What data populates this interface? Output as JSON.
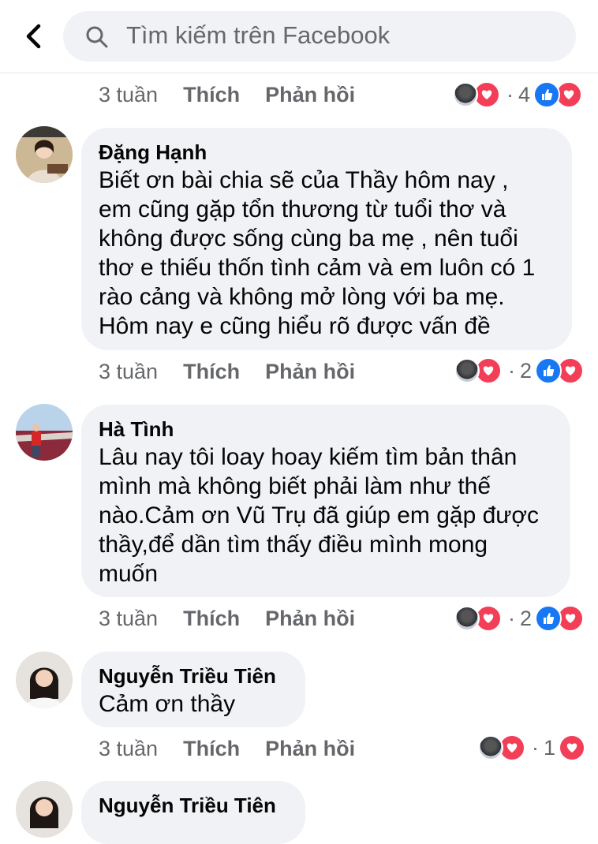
{
  "search": {
    "placeholder": "Tìm kiếm trên Facebook"
  },
  "labels": {
    "like": "Thích",
    "reply": "Phản hồi"
  },
  "colors": {
    "like_blue": "#1877f2",
    "love_red": "#f33e58",
    "bubble_bg": "#f0f2f5",
    "meta_gray": "#65676b"
  },
  "top_meta": {
    "time": "3 tuần",
    "reaction_count": "4"
  },
  "comments": [
    {
      "author": "Đặng Hạnh",
      "text": "Biết ơn bài chia sẽ của Thầy hôm nay ,\nem  cũng gặp tổn thương từ tuổi thơ và\nkhông được sống cùng ba mẹ , nên tuổi\nthơ e thiếu thốn tình cảm và em luôn có 1\nrào cảng và không mở lòng với ba mẹ.\nHôm nay e cũng hiểu rõ được vấn đề",
      "time": "3 tuần",
      "reaction_count": "2"
    },
    {
      "author": "Hà Tình",
      "text": "Lâu nay tôi loay hoay kiếm tìm bản thân\nmình mà không biết phải làm như thế\nnào.Cảm ơn Vũ Trụ đã giúp em gặp được\nthầy,để dần tìm thấy điều mình mong\nmuốn",
      "time": "3 tuần",
      "reaction_count": "2"
    },
    {
      "author": "Nguyễn Triều Tiên",
      "text": "Cảm ơn thầy",
      "time": "3 tuần",
      "reaction_count": "1"
    },
    {
      "author": "Nguyễn Triều Tiên"
    }
  ]
}
